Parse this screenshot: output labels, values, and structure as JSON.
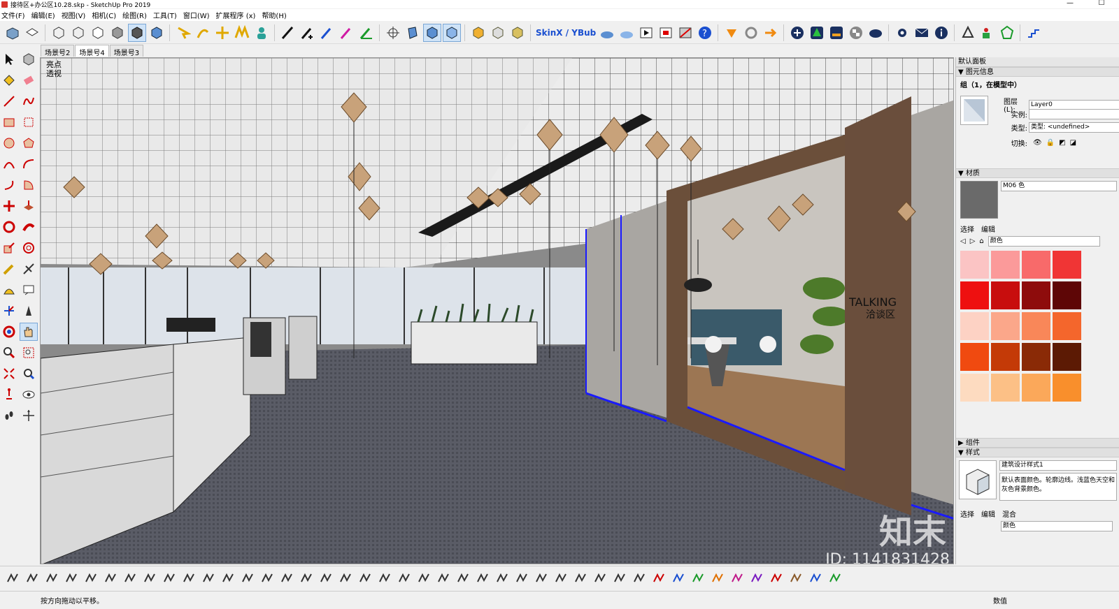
{
  "window": {
    "title": "接待区+办公区10.28.skp - SketchUp Pro 2019",
    "minimize": "—",
    "maximize": "☐"
  },
  "menu": [
    "文件(F)",
    "编辑(E)",
    "视图(V)",
    "相机(C)",
    "绘图(R)",
    "工具(T)",
    "窗口(W)",
    "扩展程序 (x)",
    "帮助(H)"
  ],
  "toolbar": {
    "skinx_label": "SkinX / YBub"
  },
  "scenes": [
    "场景号2",
    "场景号4",
    "场景号3"
  ],
  "viewport": {
    "style_line1": "亮点",
    "style_line2": "透视",
    "sign_en": "TALKING",
    "sign_cn": "洽谈区"
  },
  "tray": {
    "title": "默认面板",
    "entity_info": {
      "header": "图元信息",
      "summary": "组（1，在模型中）",
      "layer_label": "图层(L):",
      "layer_value": "Layer0",
      "instance_label": "实例:",
      "instance_value": "",
      "type_label": "类型:",
      "type_value": "类型: <undefined>",
      "toggle_label": "切换:"
    },
    "materials": {
      "header": "材质",
      "current": "M06 色",
      "tab_select": "选择",
      "tab_edit": "编辑",
      "library": "颜色",
      "swatches": [
        "#fbc4c4",
        "#fb9a9a",
        "#f86a6a",
        "#f03535",
        "#ee1010",
        "#c80d0d",
        "#8e0c0c",
        "#5e0606",
        "#fdd2c4",
        "#fba78a",
        "#f98759",
        "#f4662c",
        "#f04a10",
        "#c43a07",
        "#8a2a06",
        "#5c1a04",
        "#fddbc0",
        "#fcc086",
        "#fba85a",
        "#f98f2c"
      ]
    },
    "components": {
      "header": "组件"
    },
    "styles": {
      "header": "样式",
      "name": "建筑设计样式1",
      "description": "默认表面颜色。轮廓边线。浅蓝色天空和灰色背景颜色。",
      "tab_select": "选择",
      "tab_edit": "编辑",
      "tab_mix": "混合",
      "library": "颜色"
    }
  },
  "status": {
    "hint": "按方向拖动以平移。",
    "measure_label": "数值"
  },
  "watermark": {
    "brand": "知末",
    "id": "ID: 1141831428"
  }
}
